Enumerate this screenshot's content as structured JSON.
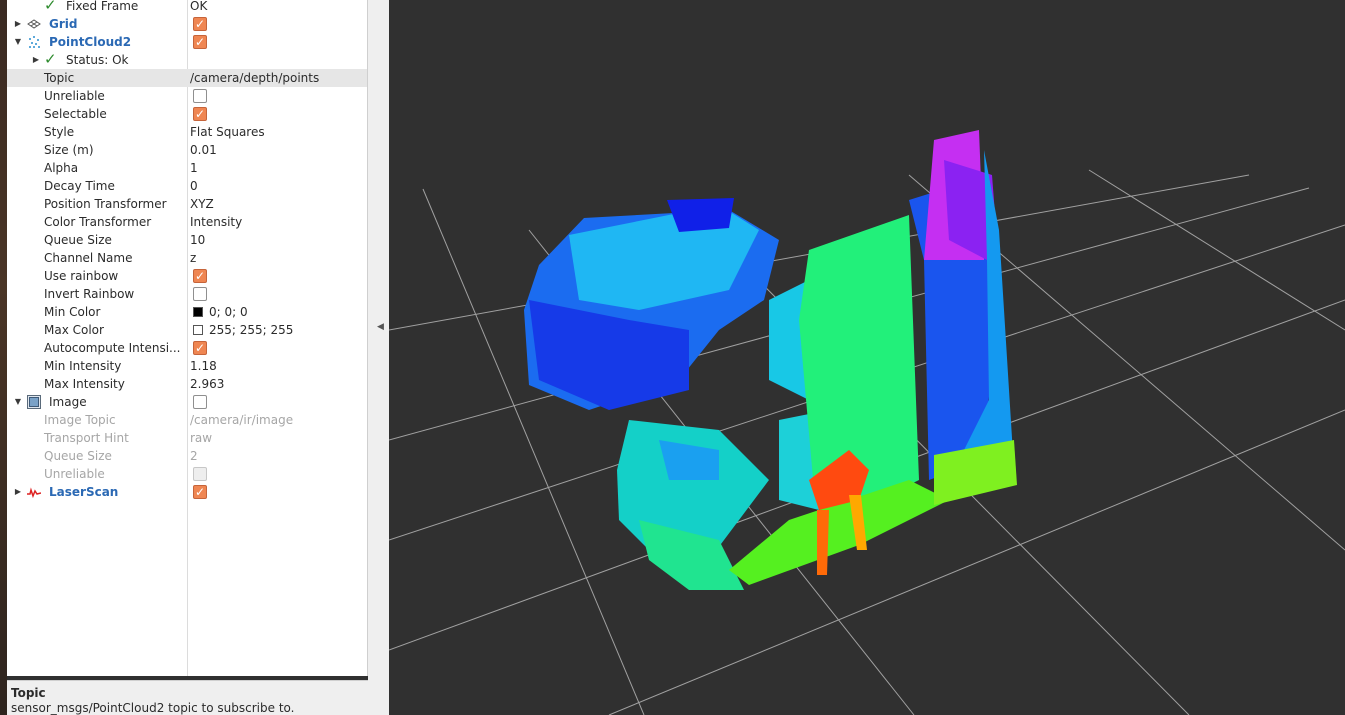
{
  "displays_panel": {
    "rows": [
      {
        "name": "Fixed Frame",
        "value": "OK"
      },
      {
        "name": "Grid"
      },
      {
        "name": "PointCloud2"
      },
      {
        "name": "Status: Ok"
      },
      {
        "name": "Topic",
        "value": "/camera/depth/points"
      },
      {
        "name": "Unreliable"
      },
      {
        "name": "Selectable"
      },
      {
        "name": "Style",
        "value": "Flat Squares"
      },
      {
        "name": "Size (m)",
        "value": "0.01"
      },
      {
        "name": "Alpha",
        "value": "1"
      },
      {
        "name": "Decay Time",
        "value": "0"
      },
      {
        "name": "Position Transformer",
        "value": "XYZ"
      },
      {
        "name": "Color Transformer",
        "value": "Intensity"
      },
      {
        "name": "Queue Size",
        "value": "10"
      },
      {
        "name": "Channel Name",
        "value": "z"
      },
      {
        "name": "Use rainbow"
      },
      {
        "name": "Invert Rainbow"
      },
      {
        "name": "Min Color",
        "value": "0; 0; 0",
        "color": "#000000"
      },
      {
        "name": "Max Color",
        "value": "255; 255; 255",
        "color": "#ffffff"
      },
      {
        "name": "Autocompute Intensi..."
      },
      {
        "name": "Min Intensity",
        "value": "1.18"
      },
      {
        "name": "Max Intensity",
        "value": "2.963"
      },
      {
        "name": "Image"
      },
      {
        "name": "Image Topic",
        "value": "/camera/ir/image"
      },
      {
        "name": "Transport Hint",
        "value": "raw"
      },
      {
        "name": "Queue Size",
        "value": "2"
      },
      {
        "name": "Unreliable"
      },
      {
        "name": "LaserScan"
      }
    ]
  },
  "description": {
    "title": "Topic",
    "text": "sensor_msgs/PointCloud2 topic to subscribe to."
  },
  "colors": {
    "background_3d": "#303030",
    "grid_line": "#a0a0a0",
    "checkbox_checked": "#ef8652",
    "group_label": "#2b69b4",
    "status_ok": "#2e8b2e"
  },
  "icons": {
    "grid": "grid-icon",
    "pointcloud": "pointcloud-icon",
    "image": "image-icon",
    "laserscan": "laserscan-icon",
    "status": "checkmark-icon"
  }
}
